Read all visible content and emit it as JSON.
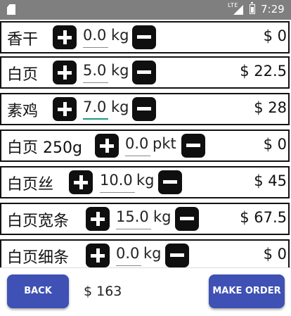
{
  "status_bar": {
    "network": "LTE",
    "time": "7:29"
  },
  "items": [
    {
      "name": "香干",
      "quantity": "0.0",
      "unit": "kg",
      "price": "$ 0"
    },
    {
      "name": "白页",
      "quantity": "5.0",
      "unit": "kg",
      "price": "$ 22.5"
    },
    {
      "name": "素鸡",
      "quantity": "7.0",
      "unit": "kg",
      "price": "$ 28"
    },
    {
      "name": "白页 250g",
      "quantity": "0.0",
      "unit": "pkt",
      "price": "$ 0"
    },
    {
      "name": "白页丝",
      "quantity": "10.0",
      "unit": "kg",
      "price": "$ 45"
    },
    {
      "name": "白页宽条",
      "quantity": "15.0",
      "unit": "kg",
      "price": "$ 67.5"
    },
    {
      "name": "白页细条",
      "quantity": "0.0",
      "unit": "kg",
      "price": "$ 0"
    }
  ],
  "footer": {
    "back_label": "BACK",
    "total": "$ 163",
    "order_label": "MAKE ORDER"
  },
  "colors": {
    "status_bar": "#7f7f7f",
    "button_primary": "#3f51b5",
    "input_focus": "#1a9a87"
  }
}
